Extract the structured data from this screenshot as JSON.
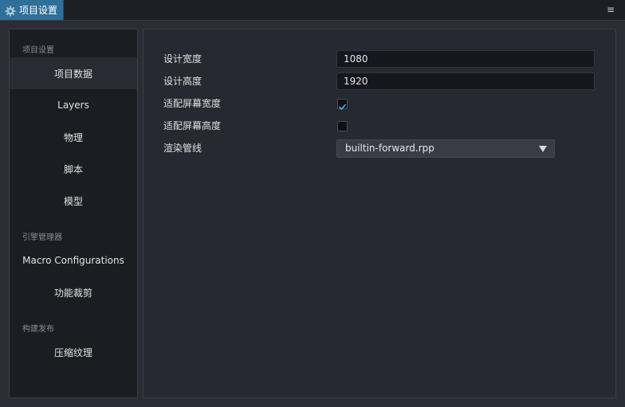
{
  "tab": {
    "title": "项目设置",
    "icon": "gear-icon"
  },
  "menu_icon": "≡",
  "sidebar": {
    "groups": [
      {
        "title": "项目设置",
        "items": [
          "项目数据",
          "Layers",
          "物理",
          "脚本",
          "模型"
        ]
      },
      {
        "title": "引擎管理器",
        "items": [
          "Macro Configurations",
          "功能裁剪"
        ]
      },
      {
        "title": "构建发布",
        "items": [
          "压缩纹理"
        ]
      }
    ],
    "active": "项目数据"
  },
  "properties": {
    "design_width": {
      "label": "设计宽度",
      "value": "1080"
    },
    "design_height": {
      "label": "设计高度",
      "value": "1920"
    },
    "fit_width": {
      "label": "适配屏幕宽度",
      "checked": true
    },
    "fit_height": {
      "label": "适配屏幕高度",
      "checked": false
    },
    "render_pipeline": {
      "label": "渲染管线",
      "value": "builtin-forward.rpp"
    }
  },
  "colors": {
    "accent": "#2f6f98",
    "check": "#4aa3d8"
  }
}
